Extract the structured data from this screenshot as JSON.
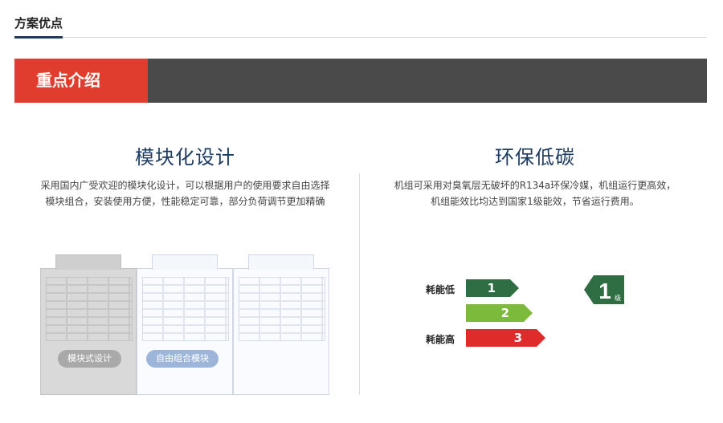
{
  "header": {
    "title": "方案优点"
  },
  "banner": {
    "label": "重点介绍"
  },
  "left": {
    "heading": "模块化设计",
    "line1": "采用国内广受欢迎的模块化设计，可以根据用户的使用要求自由选择",
    "line2": "模块组合，安装使用方便，性能稳定可靠，部分负荷调节更加精确",
    "tag_left": "模块式设计",
    "tag_right": "自由组合模块"
  },
  "right": {
    "heading": "环保低碳",
    "line1": "机组可采用对臭氧层无破坏的R134a环保冷媒，机组运行更高效，",
    "line2": "机组能效比均达到国家1级能效，节省运行费用。",
    "energy": {
      "low_label": "耗能低",
      "high_label": "耗能高",
      "levels": [
        "1",
        "2",
        "3"
      ],
      "badge_number": "1",
      "badge_unit": "级",
      "colors": [
        "#2f6e43",
        "#7cba3c",
        "#e02b2b"
      ]
    }
  },
  "colors": {
    "accent_red": "#e13d2e",
    "banner_gray": "#4a4a4a",
    "heading_blue": "#1d3a5f"
  }
}
